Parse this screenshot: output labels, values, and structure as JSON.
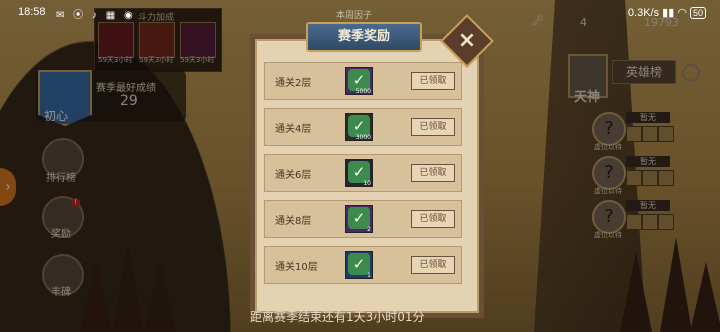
{
  "status_bar": {
    "time": "18:58",
    "notification_icons": "✉ ⦿ ♪ ▦ ◉",
    "network": "0.3K/s",
    "battery": "50"
  },
  "buff_panel": {
    "title": "斗力加成",
    "items": [
      {
        "label": "59天3小时",
        "count": "1"
      },
      {
        "label": "59天3小时",
        "count": "3"
      },
      {
        "label": "59天3小时",
        "count": "1"
      }
    ]
  },
  "season": {
    "rank_name": "初心",
    "best_label": "赛季最好成绩",
    "best_value": "29"
  },
  "side_menu": [
    {
      "label": "排行榜"
    },
    {
      "label": "奖励",
      "badge": "!"
    },
    {
      "label": "丰碑"
    }
  ],
  "top_right": {
    "key_count": "4",
    "progress": "19793"
  },
  "hero_board": {
    "title": "英雄榜",
    "rank": "天神",
    "slots": [
      {
        "status": "暂无",
        "label": "虚位以待"
      },
      {
        "status": "暂无",
        "label": "虚位以待"
      },
      {
        "status": "暂无",
        "label": "虚位以待"
      }
    ]
  },
  "background_top_label": "本周因子",
  "dialog": {
    "title": "赛季奖励",
    "rows": [
      {
        "label": "通关2层",
        "count": "5000",
        "item_color": "#4a2a66",
        "claim_label": "已领取"
      },
      {
        "label": "通关4层",
        "count": "3000",
        "item_color": "#2a2a2a",
        "claim_label": "已领取"
      },
      {
        "label": "通关6层",
        "count": "10",
        "item_color": "#2a2230",
        "claim_label": "已领取"
      },
      {
        "label": "通关8层",
        "count": "2",
        "item_color": "#4a2a66",
        "claim_label": "已领取"
      },
      {
        "label": "通关10层",
        "count": "1",
        "item_color": "#1e3a6a",
        "claim_label": "已领取"
      }
    ],
    "footer": "距离赛季结束还有1天3小时01分"
  }
}
